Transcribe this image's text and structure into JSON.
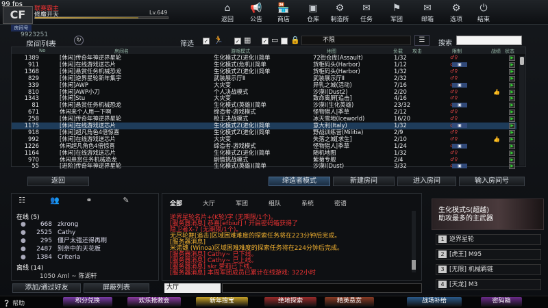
{
  "fps": "99 fps",
  "logo": "CF",
  "player": {
    "rank_name": "联赛霸主",
    "name": "修魔开天",
    "level": "Lv.649",
    "xp_fraction": 0.78
  },
  "nav": [
    {
      "label": "返回",
      "icon": "back-icon",
      "glyph": "⌂"
    },
    {
      "label": "公告",
      "icon": "announcement-icon",
      "glyph": "📢"
    },
    {
      "label": "商店",
      "icon": "shop-icon",
      "glyph": "🏪"
    },
    {
      "label": "仓库",
      "icon": "warehouse-icon",
      "glyph": "▣"
    },
    {
      "label": "制造所",
      "icon": "factory-icon",
      "glyph": "⚙"
    },
    {
      "label": "任务",
      "icon": "task-icon",
      "glyph": "✉"
    },
    {
      "label": "军团",
      "icon": "legion-icon",
      "glyph": "⚑"
    },
    {
      "label": "邮箱",
      "icon": "mail-icon",
      "glyph": "✉"
    },
    {
      "label": "选项",
      "icon": "options-icon",
      "glyph": "⚙"
    },
    {
      "label": "结束",
      "icon": "power-icon",
      "glyph": "⏻"
    }
  ],
  "room": {
    "badge": "房间号",
    "id": "9923251",
    "lobby_title": "房间列表"
  },
  "filter": {
    "label": "筛选",
    "select_value": "不限",
    "search_label": "搜索"
  },
  "table": {
    "headers": [
      "No",
      "房间名",
      "游戏模式",
      "地图",
      "负载",
      "攻击",
      "限制",
      "战绩",
      "状态"
    ],
    "rows": [
      [
        "1389",
        "[休闲]传奇年神逆界星轮",
        "生化模式Z(进化)(简单",
        "72街仓库(Assault)",
        "1/32"
      ],
      [
        "911",
        "[休闲]在线游戏送芯片",
        "生化模式(危机)(简单",
        "货柜码头(Harbor)",
        "1/12"
      ],
      [
        "1368",
        "[休闲]悬赏任务机械恐龙",
        "生化模式Z(进化)(简单",
        "货柜码头(Harbor)",
        "1/32"
      ],
      [
        "829",
        "[休闲]逆界星轮新年集宇",
        "武装展示厅Ⅱ",
        "武装展示厅Ⅱ",
        "2/32"
      ],
      [
        "339",
        "[休闲]AWP",
        "大灾变",
        "异乳之城(活动)",
        "7/16"
      ],
      [
        "810",
        "[休闲]AWP小刀",
        "个人决战模式",
        "沙漠Ⅰ(Dust2)",
        "2/20"
      ],
      [
        "1343",
        "[休闲]Stu",
        "大灾变",
        "致命离屏[追击]",
        "4/16"
      ],
      [
        "81",
        "[休闲]悬赏任务机械恐龙",
        "生化模式(英雄)(简单",
        "沙漠Ⅰ(生化英雄)",
        "23/32"
      ],
      [
        "671",
        "休闲来个人用一下啊",
        "缔造者-游戏模式",
        "怪物猎人|季草",
        "2/12"
      ],
      [
        "258",
        "[休闲]传奇年神逆界星轮",
        "枪王决战模式",
        "冰天雪地(Iceworld)",
        "16/20"
      ],
      [
        "1175",
        "[休闲]在线游戏送芯片",
        "生化模式Z(进化)(简单",
        "意大利(Italy)",
        "1/32"
      ],
      [
        "918",
        "[休闲]超凡角色4倍惊喜",
        "生化模式Z(进化)(简单",
        "野战训练营(Militia)",
        "2/9"
      ],
      [
        "992",
        "[休闲]在线游戏送芯片",
        "大灾变",
        "失落之城[求生]",
        "2/10"
      ],
      [
        "1226",
        "休闲超凡角色4倍惊喜",
        "缔造者-游戏模式",
        "怪物猎人|季草",
        "1/24"
      ],
      [
        "1164",
        "[休闲]在线游戏送芯片",
        "生化模式Z(进化)(简单",
        "随机地图",
        "1/32"
      ],
      [
        "970",
        "休闲悬赏任务机械恐龙",
        "剧情挑战模式",
        "紫菊专舰",
        "2/4"
      ],
      [
        "55",
        "[进阶]传奇年神逆界星轮",
        "生化模式(英雄)(简单",
        "沙漠Ⅰ(Dust)",
        "3/32"
      ]
    ]
  },
  "buttons": {
    "back": "返回",
    "creator": "缔造者模式",
    "new_room": "新建房间",
    "enter_room": "进入房间",
    "input_room": "输入房间号"
  },
  "friends": {
    "online_label": "在线 (5)",
    "offline_label": "离线 (14)",
    "items": [
      {
        "v": "668",
        "name": "zkrong"
      },
      {
        "v": "2525",
        "name": "Cathy"
      },
      {
        "v": "295",
        "name": "僵尸太强还得再刷"
      },
      {
        "v": "2487",
        "name": "别奈中的天花板"
      },
      {
        "v": "1384",
        "name": "Criteria"
      }
    ],
    "offline_item": {
      "v": "1050",
      "name": "Aml ~ 陈湖轩"
    },
    "add_button": "添加/通过好友",
    "block_button": "屏蔽列表"
  },
  "chat": {
    "tabs": [
      "全部",
      "大厅",
      "军团",
      "组队",
      "系统",
      "密语"
    ],
    "lines": [
      {
        "t": "逆界星轮名片+(K轮)字 (无期限/1个)。",
        "c": "#e33"
      },
      {
        "t": "[服务器消息] 恭喜[efbiuf] ! 开启密码箱获得了",
        "c": "#e33"
      },
      {
        "t": "隐卫者X-7 (无期限/1个)。",
        "c": "#e33"
      },
      {
        "t": "无尽轮舞[追击]区域困难难度的探索任务将在223分钟后完成。",
        "c": "#f0b030"
      },
      {
        "t": "[服务器消息]",
        "c": "#f0b030"
      },
      {
        "t": "米诺魏 (Winoa)区域困难难度的探索任务将在224分钟后完成。",
        "c": "#f0b030"
      },
      {
        "t": "[服务器消息] Cathy~ 已下线。",
        "c": "#e33"
      },
      {
        "t": "[服务器消息] Cathy~ 已上线。",
        "c": "#e33"
      },
      {
        "t": "[服务器消息] skr 萝莉已下线。",
        "c": "#e33"
      },
      {
        "t": "[服务器消息] 本周军团成员已累计在线游戏: 322小时",
        "c": "#e33"
      }
    ],
    "channel": "大厅"
  },
  "promo": {
    "title": "生化模式S(超越)",
    "subtitle": "助攻最多的主武器",
    "items": [
      {
        "n": "1",
        "label": "逆界星轮"
      },
      {
        "n": "2",
        "label": "[虎王] M95"
      },
      {
        "n": "3",
        "label": "[无限] 机械羁链"
      },
      {
        "n": "4",
        "label": "[天龙] M3"
      }
    ]
  },
  "bottom": {
    "help": "帮助",
    "buttons": [
      {
        "label": "积分兑换",
        "color": "#7a3aa8"
      },
      {
        "label": "欢乐抢救会",
        "color": "#8a3aa0"
      },
      {
        "label": "新年搜宝",
        "color": "#c8a228"
      },
      {
        "label": "绝地探索",
        "color": "#9a2a2a"
      },
      {
        "label": "精英悬赏",
        "color": "#8a3a24"
      },
      {
        "label": "战场补给",
        "color": "#2a5a8a"
      },
      {
        "label": "密码箱",
        "color": "#6a2a8a"
      }
    ]
  }
}
